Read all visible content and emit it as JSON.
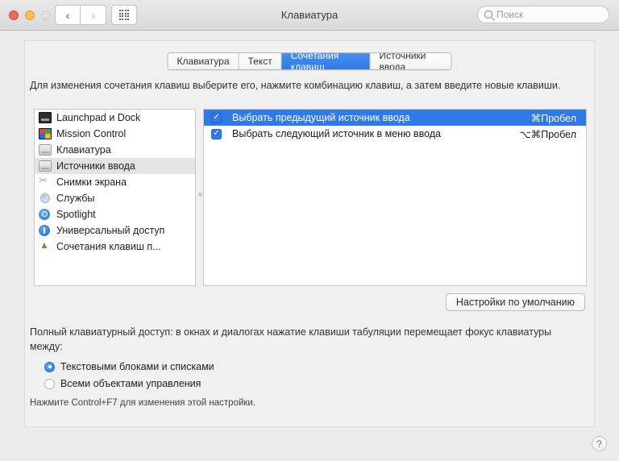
{
  "window": {
    "title": "Клавиатура",
    "traffic_lights": [
      "close",
      "minimize",
      "zoom"
    ],
    "nav": {
      "back": "‹",
      "forward": "›"
    },
    "grid_button": "grid-icon"
  },
  "search": {
    "placeholder": "Поиск",
    "value": ""
  },
  "tabs": [
    {
      "label": "Клавиатура",
      "active": false
    },
    {
      "label": "Текст",
      "active": false
    },
    {
      "label": "Сочетания клавиш",
      "active": true
    },
    {
      "label": "Источники ввода",
      "active": false
    }
  ],
  "instructions": "Для изменения сочетания клавиш выберите его, нажмите комбинацию клавиш, а затем введите новые клавиши.",
  "categories": [
    {
      "label": "Launchpad и Dock",
      "icon": "launchpad-icon",
      "selected": false
    },
    {
      "label": "Mission Control",
      "icon": "mission-control-icon",
      "selected": false
    },
    {
      "label": "Клавиатура",
      "icon": "keyboard-icon",
      "selected": false
    },
    {
      "label": "Источники ввода",
      "icon": "input-sources-icon",
      "selected": true
    },
    {
      "label": "Снимки экрана",
      "icon": "screenshot-icon",
      "selected": false
    },
    {
      "label": "Службы",
      "icon": "services-icon",
      "selected": false
    },
    {
      "label": "Spotlight",
      "icon": "spotlight-icon",
      "selected": false
    },
    {
      "label": "Универсальный доступ",
      "icon": "accessibility-icon",
      "selected": false
    },
    {
      "label": "Сочетания клавиш п...",
      "icon": "app-shortcuts-icon",
      "selected": false
    }
  ],
  "shortcuts": [
    {
      "checked": true,
      "name": "Выбрать предыдущий источник ввода",
      "key": "⌘Пробел",
      "selected": true
    },
    {
      "checked": true,
      "name": "Выбрать следующий источник в меню ввода",
      "key": "⌥⌘Пробел",
      "selected": false
    }
  ],
  "checkmark": "✓",
  "defaults_button": "Настройки по умолчанию",
  "full_keyboard_access": {
    "description": "Полный клавиатурный доступ: в окнах и диалогах нажатие клавиши табуляции перемещает фокус клавиатуры между:",
    "options": [
      {
        "label": "Текстовыми блоками и списками",
        "selected": true
      },
      {
        "label": "Всеми объектами управления",
        "selected": false
      }
    ],
    "hint": "Нажмите Control+F7 для изменения этой настройки."
  },
  "help_button": "?",
  "colors": {
    "accent": "#2f7ae5",
    "selection": "#2f7ae5",
    "window_bg": "#ececec",
    "panel_bg": "#f0f0f0"
  }
}
